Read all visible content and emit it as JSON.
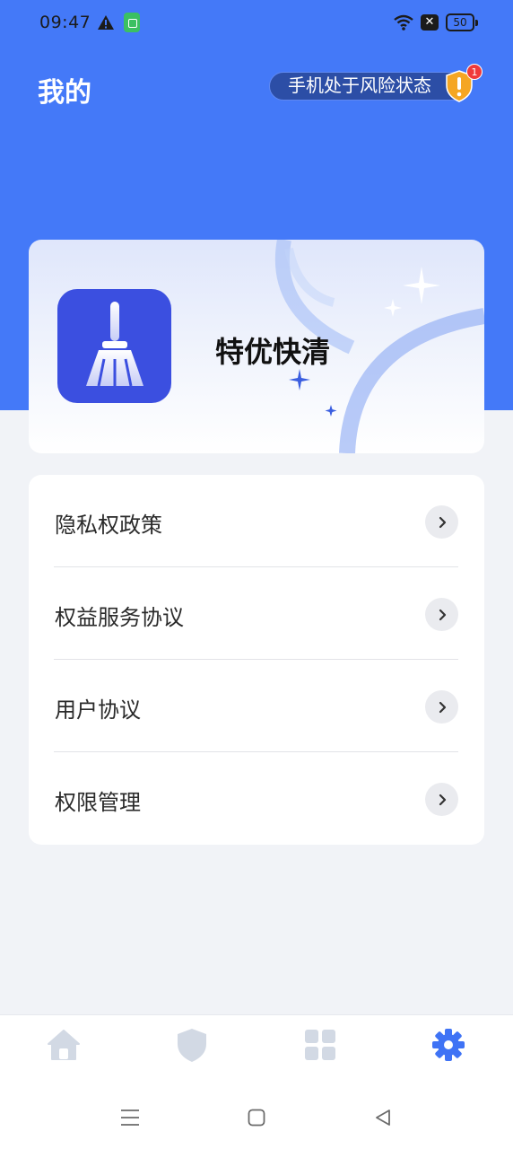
{
  "status_bar": {
    "time": "09:47",
    "battery": "50",
    "icons": [
      "warning-icon",
      "app-notification-icon",
      "wifi-icon",
      "no-sim-icon",
      "battery-icon"
    ]
  },
  "header": {
    "title": "我的",
    "risk_status": "手机处于风险状态",
    "risk_badge_count": "1"
  },
  "app_card": {
    "app_name": "特优快清",
    "icon": "broom-icon"
  },
  "menu": {
    "items": [
      {
        "label": "隐私权政策"
      },
      {
        "label": "权益服务协议"
      },
      {
        "label": "用户协议"
      },
      {
        "label": "权限管理"
      }
    ]
  },
  "bottom_nav": {
    "items": [
      {
        "icon": "home-icon",
        "active": false
      },
      {
        "icon": "shield-icon",
        "active": false
      },
      {
        "icon": "grid-icon",
        "active": false
      },
      {
        "icon": "gear-icon",
        "active": true
      }
    ]
  },
  "colors": {
    "header_blue": "#4479f8",
    "active_nav": "#3f73f5",
    "inactive_nav": "#d2d9e4",
    "app_icon_bg": "#3b4fe0",
    "badge_red": "#f03a3a",
    "risk_shield": "#f5a623"
  }
}
